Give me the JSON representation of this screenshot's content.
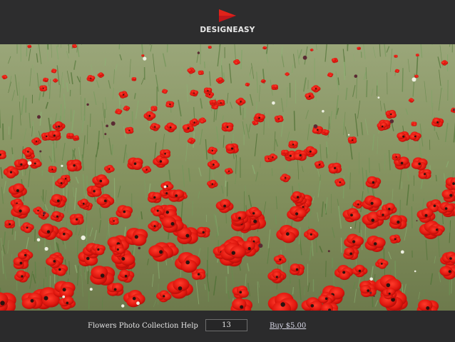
{
  "header": {
    "brand": "DESIGNEASY",
    "logo_icon": "play-triangle-logo",
    "logo_color": "#c0161b"
  },
  "photo": {
    "alt_subject": "poppy-field",
    "accent": "#e0231a"
  },
  "footer": {
    "help_label": "Flowers Photo Collection Help",
    "quantity_value": "13",
    "buy_label": "Buy $5.00"
  }
}
